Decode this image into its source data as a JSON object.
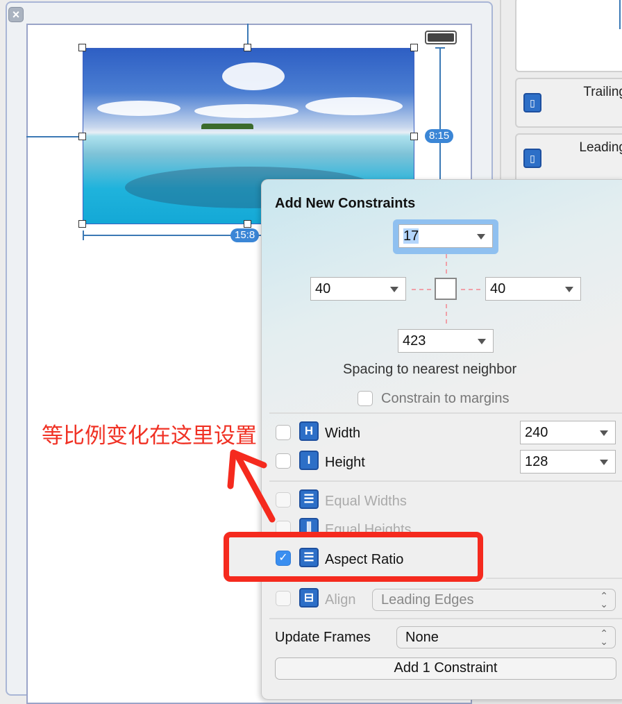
{
  "canvas": {
    "close_icon": "×",
    "aspect_badge_vertical": "8:15",
    "aspect_badge_horizontal": "15:8"
  },
  "right_panel": {
    "items": [
      {
        "label": "Trailing",
        "icon": "trailing-icon"
      },
      {
        "label": "Leading",
        "icon": "leading-icon"
      }
    ]
  },
  "popover": {
    "title": "Add New Constraints",
    "spacing": {
      "top": "17",
      "left": "40",
      "right": "40",
      "bottom": "423"
    },
    "spacing_caption": "Spacing to nearest neighbor",
    "constrain_to_margins": {
      "label": "Constrain to margins",
      "checked": false
    },
    "width": {
      "label": "Width",
      "value": "240",
      "checked": false
    },
    "height": {
      "label": "Height",
      "value": "128",
      "checked": false
    },
    "equal_widths": {
      "label": "Equal Widths",
      "checked": false,
      "enabled": false
    },
    "equal_heights": {
      "label": "Equal Heights",
      "checked": false,
      "enabled": false
    },
    "aspect_ratio": {
      "label": "Aspect Ratio",
      "checked": true
    },
    "align": {
      "label": "Align",
      "value": "Leading Edges",
      "checked": false,
      "enabled": false
    },
    "update_frames": {
      "label": "Update Frames",
      "value": "None"
    },
    "add_button": "Add 1 Constraint"
  },
  "annotation": {
    "text": "等比例变化在这里设置",
    "color": "#f03124"
  },
  "colors": {
    "accent": "#3a8ef0",
    "constraint_line": "#3b79b5",
    "annotation_red": "#f52a1e"
  }
}
